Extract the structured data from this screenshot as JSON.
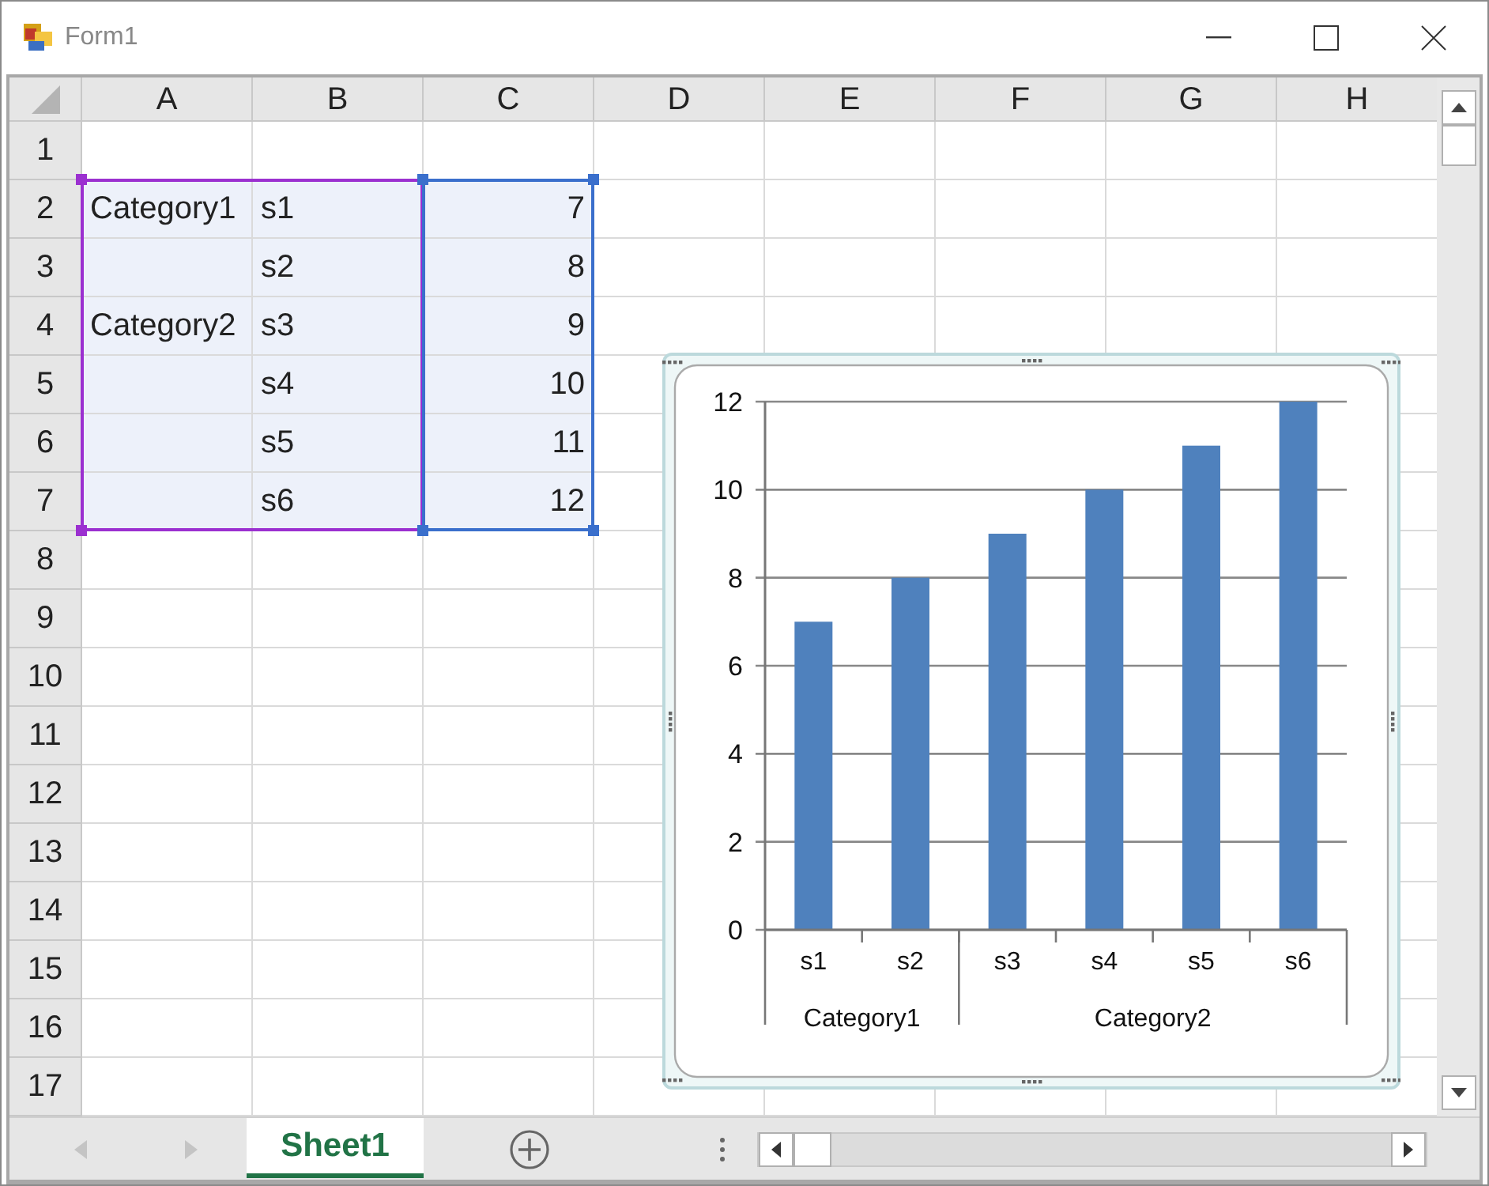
{
  "window": {
    "title": "Form1"
  },
  "columns": [
    {
      "label": "A",
      "color": "#9b30d0"
    },
    {
      "label": "B",
      "color": "#9b30d0"
    },
    {
      "label": "C",
      "color": "#3a6fcc"
    },
    {
      "label": "D"
    },
    {
      "label": "E"
    },
    {
      "label": "F"
    },
    {
      "label": "G"
    },
    {
      "label": "H"
    }
  ],
  "rows": [
    {
      "number": "1",
      "in_range": false
    },
    {
      "number": "2",
      "in_range": true,
      "cells": [
        {
          "text": "Category1",
          "kind": "text"
        },
        {
          "text": "s1",
          "kind": "text"
        },
        {
          "text": "7",
          "kind": "number"
        }
      ]
    },
    {
      "number": "3",
      "in_range": true,
      "cells": [
        {
          "kind": "text"
        },
        {
          "text": "s2",
          "kind": "text"
        },
        {
          "text": "8",
          "kind": "number"
        }
      ]
    },
    {
      "number": "4",
      "in_range": true,
      "cells": [
        {
          "text": "Category2",
          "kind": "text"
        },
        {
          "text": "s3",
          "kind": "text"
        },
        {
          "text": "9",
          "kind": "number"
        }
      ]
    },
    {
      "number": "5",
      "in_range": true,
      "cells": [
        {
          "kind": "text"
        },
        {
          "text": "s4",
          "kind": "text"
        },
        {
          "text": "10",
          "kind": "number"
        }
      ]
    },
    {
      "number": "6",
      "in_range": true,
      "cells": [
        {
          "kind": "text"
        },
        {
          "text": "s5",
          "kind": "text"
        },
        {
          "text": "11",
          "kind": "number"
        }
      ]
    },
    {
      "number": "7",
      "in_range": true,
      "cells": [
        {
          "kind": "text"
        },
        {
          "text": "s6",
          "kind": "text"
        },
        {
          "text": "12",
          "kind": "number"
        }
      ]
    },
    {
      "number": "8",
      "in_range": false
    },
    {
      "number": "9",
      "in_range": false
    },
    {
      "number": "10",
      "in_range": false
    },
    {
      "number": "11",
      "in_range": false
    },
    {
      "number": "12",
      "in_range": false
    },
    {
      "number": "13",
      "in_range": false
    },
    {
      "number": "14",
      "in_range": false
    },
    {
      "number": "15",
      "in_range": false
    },
    {
      "number": "16",
      "in_range": false
    },
    {
      "number": "17",
      "in_range": false
    }
  ],
  "chart": {
    "selected": true,
    "category_groups": [
      {
        "label": "Category1",
        "categories": [
          "s1",
          "s2"
        ]
      },
      {
        "label": "Category2",
        "categories": [
          "s3",
          "s4",
          "s5",
          "s6"
        ]
      }
    ],
    "chart_data": {
      "type": "bar",
      "grid": true,
      "series": [
        {
          "color": "#4f81bd",
          "values": [
            7,
            8,
            9,
            10,
            11,
            12
          ]
        }
      ],
      "ylim": [
        0,
        12
      ],
      "yticks": [
        0,
        2,
        4,
        6,
        8,
        10,
        12
      ]
    }
  },
  "sheet_tabs": [
    {
      "label": "Sheet1",
      "selected": true
    }
  ]
}
